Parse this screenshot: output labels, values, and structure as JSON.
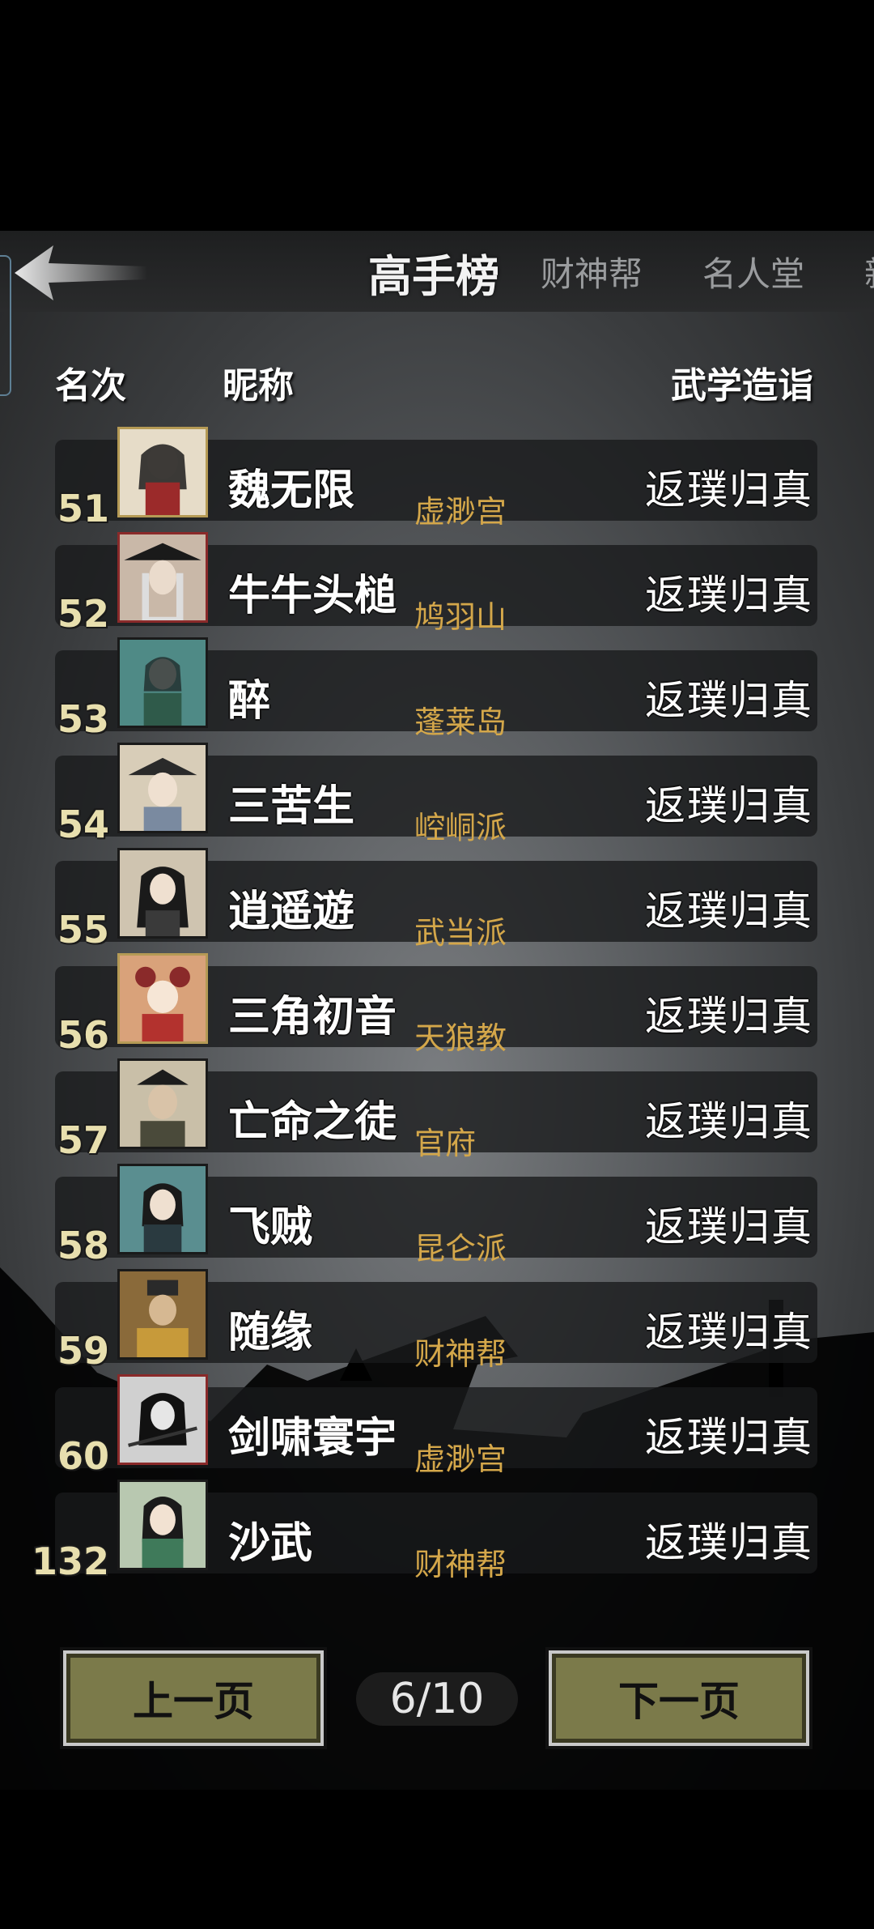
{
  "tabs": [
    {
      "label": "高手榜",
      "active": true
    },
    {
      "label": "财神帮",
      "active": false
    },
    {
      "label": "名人堂",
      "active": false
    },
    {
      "label": "新",
      "active": false
    }
  ],
  "headers": {
    "rank": "名次",
    "nickname": "昵称",
    "skill": "武学造诣"
  },
  "rows": [
    {
      "rank": "51",
      "name": "魏无限",
      "sect": "虚渺宫",
      "skill": "返璞归真"
    },
    {
      "rank": "52",
      "name": "牛牛头槌",
      "sect": "鸠羽山",
      "skill": "返璞归真"
    },
    {
      "rank": "53",
      "name": "醉",
      "sect": "蓬莱岛",
      "skill": "返璞归真"
    },
    {
      "rank": "54",
      "name": "三苦生",
      "sect": "崆峒派",
      "skill": "返璞归真"
    },
    {
      "rank": "55",
      "name": "逍遥遊",
      "sect": "武当派",
      "skill": "返璞归真"
    },
    {
      "rank": "56",
      "name": "三角初音",
      "sect": "天狼教",
      "skill": "返璞归真"
    },
    {
      "rank": "57",
      "name": "亡命之徒",
      "sect": "官府",
      "skill": "返璞归真"
    },
    {
      "rank": "58",
      "name": "飞贼",
      "sect": "昆仑派",
      "skill": "返璞归真"
    },
    {
      "rank": "59",
      "name": "随缘",
      "sect": "财神帮",
      "skill": "返璞归真"
    },
    {
      "rank": "60",
      "name": "剑啸寰宇",
      "sect": "虚渺宫",
      "skill": "返璞归真"
    },
    {
      "rank": "132",
      "name": "沙武",
      "sect": "财神帮",
      "skill": "返璞归真"
    }
  ],
  "pager": {
    "prev": "上一页",
    "next": "下一页",
    "indicator": "6/10"
  },
  "colors": {
    "sect": "#d4a74a",
    "rank": "#e8dfae",
    "button": "#7b7a4a"
  }
}
